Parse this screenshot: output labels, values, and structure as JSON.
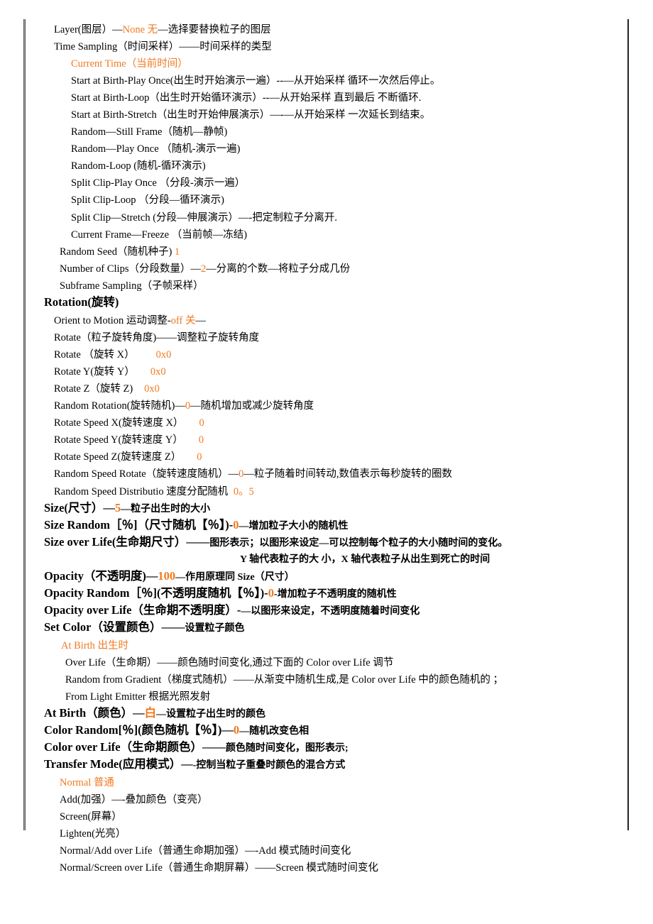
{
  "colors": {
    "accent": "#f07a20",
    "text": "#000000"
  },
  "layer": {
    "label": "Layer(图层）—",
    "value": "None 无",
    "desc": "—选择要替换粒子的图层"
  },
  "time_sampling": {
    "label": "Time Sampling（时间采样）——时间采样的类型",
    "current": "Current Time（当前时间）",
    "options": [
      "Start at Birth-Play Once(出生时开始演示一遍）--—从开始采样  循环一次然后停止。",
      "Start at Birth-Loop（出生时开始循环演示）--—从开始采样  直到最后  不断循环.",
      "Start at Birth-Stretch（出生时开始伸展演示）—-—从开始采样  一次延长到结束。",
      "Random—Still Frame（随机—静帧)",
      "Random—Play Once  （随机-演示一遍)",
      "Random-Loop (随机-循环演示)",
      "Split Clip-Play Once  （分段-演示一遍）",
      "Split Clip-Loop  （分段—循环演示)",
      "Split Clip—Stretch (分段—伸展演示）—-把定制粒子分离开.",
      "Current Frame—Freeze  （当前帧—冻结)"
    ]
  },
  "random_seed": {
    "label": "Random Seed（随机种子) ",
    "value": "1"
  },
  "number_of_clips": {
    "label": "Number of Clips（分段数量）—",
    "value": "2",
    "desc": "—分离的个数—将粒子分成几份"
  },
  "subframe_sampling": {
    "label": "Subframe Sampling（子帧采样）"
  },
  "rotation": {
    "heading": "Rotation(旋转)",
    "orient": {
      "label": "Orient to Motion 运动调整-",
      "value": "off 关",
      "desc": "—"
    },
    "rotate_desc": "Rotate（粒子旋转角度)——调整粒子旋转角度",
    "rotate_x": {
      "label": "Rotate  （旋转 X）",
      "value": "0x0"
    },
    "rotate_y": {
      "label": "Rotate Y(旋转 Y）",
      "value": "0x0"
    },
    "rotate_z": {
      "label": "Rotate Z（旋转 Z)",
      "value": "0x0"
    },
    "random_rotation": {
      "label": "Random Rotation(旋转随机)—",
      "value": "0",
      "desc": "—随机增加或减少旋转角度"
    },
    "speed_x": {
      "label": "Rotate Speed X(旋转速度 X）",
      "value": "0"
    },
    "speed_y": {
      "label": "Rotate Speed Y(旋转速度 Y）",
      "value": "0"
    },
    "speed_z": {
      "label": "Rotate Speed Z(旋转速度 Z）",
      "value": "0"
    },
    "random_speed_rotate": {
      "label": "Random Speed Rotate（旋转速度随机）—",
      "value": "0",
      "desc": "—粒子随着时间转动,数值表示每秒旋转的圈数"
    },
    "random_speed_distribution": {
      "label": "Random Speed Distributio 速度分配随机  ",
      "value": "0。5"
    }
  },
  "size": {
    "label": "Size(尺寸）—",
    "value": "5",
    "desc": "—粒子出生时的大小"
  },
  "size_random": {
    "label": "Size Random［％]（尺寸随机【％】)-",
    "value": "0",
    "desc": "—增加粒子大小的随机性"
  },
  "size_over_life": {
    "label": "Size over Life(生命期尺寸）——",
    "desc": "图形表示；以图形来设定—可以控制每个粒子的大小随时间的变化。",
    "note": "Y 轴代表粒子的大  小，X 轴代表粒子从出生到死亡的时间"
  },
  "opacity": {
    "label": "Opacity（不透明度)—",
    "value": "100",
    "desc": "—作用原理同 Size（尺寸）"
  },
  "opacity_random": {
    "label": "Opacity Random［％](不透明度随机【％】)-",
    "value": "0",
    "desc": "-增加粒子不透明度的随机性"
  },
  "opacity_over_life": {
    "label": "Opacity over Life（生命期不透明度）-",
    "desc": "—以图形来设定，不透明度随着时间变化"
  },
  "set_color": {
    "label": "Set Color（设置颜色）——",
    "desc": "设置粒子颜色",
    "current": "At Birth 出生时",
    "options": [
      "Over Life（生命期）——颜色随时间变化,通过下面的 Color over Life 调节",
      "Random from Gradient（梯度式随机）——从渐变中随机生成,是 Color over Life 中的颜色随机的 ；",
      "From Light Emitter 根据光照发射"
    ]
  },
  "at_birth": {
    "label": "At Birth（颜色）—",
    "value": "白",
    "desc": "—设置粒子出生时的颜色"
  },
  "color_random": {
    "label": "Color Random[％](颜色随机【％】)—",
    "value": "0",
    "desc": "—随机改变色相"
  },
  "color_over_life": {
    "label": "Color over Life（生命期颜色）——",
    "desc": "颜色随时间变化，图形表示;"
  },
  "transfer_mode": {
    "label": "Transfer Mode(应用模式）—",
    "desc": "-控制当粒子重叠时颜色的混合方式",
    "current": "Normal 普通",
    "options": [
      "Add(加强）—-叠加颜色（变亮）",
      "Screen(屏幕）",
      "Lighten(光亮）",
      "Normal/Add over Life（普通生命期加强）—-Add 模式随时间变化",
      "Normal/Screen over Life（普通生命期屏幕）——Screen 模式随时间变化"
    ]
  }
}
